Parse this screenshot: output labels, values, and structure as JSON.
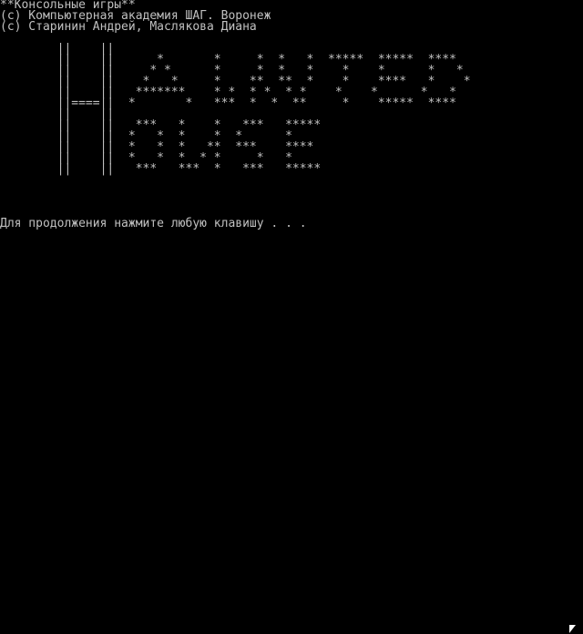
{
  "console": {
    "header_line1": "**Консольные игры**",
    "header_line2": "(c) Компьютерная академия ШАГ. Воронеж",
    "header_line3": "(c) Старинин Андрей, Маслякова Диана",
    "art": "        ||    ||\n        ||    ||      *       *     *  *   *  *****  *****  ****\n        ||    ||     * *      *     *  *   *    *    *      *   *\n        ||    ||    *   *     *    **  **  *    *    ****   *    *\n        ||    ||   *******    * *  * *  * *    *    *      *   *\n        ||====||  *       *   ***  *  *  **     *    *****  ****\n        ||    ||\n        ||    ||   ***   *    *   ***   *****\n        ||    ||  *   *  *    *  *      *\n        ||    ||  *   *  *   **  ***    ****\n        ||    ||  *   *  *  * *     *   *\n        ||    ||   ***   ***  *   ***   *****",
    "prompt": "Для продолжения нажмите любую клавишу . . ."
  },
  "colors": {
    "background": "#000000",
    "text": "#c0c0c0"
  },
  "icons": {
    "cursor": "mouse-pointer-icon"
  }
}
